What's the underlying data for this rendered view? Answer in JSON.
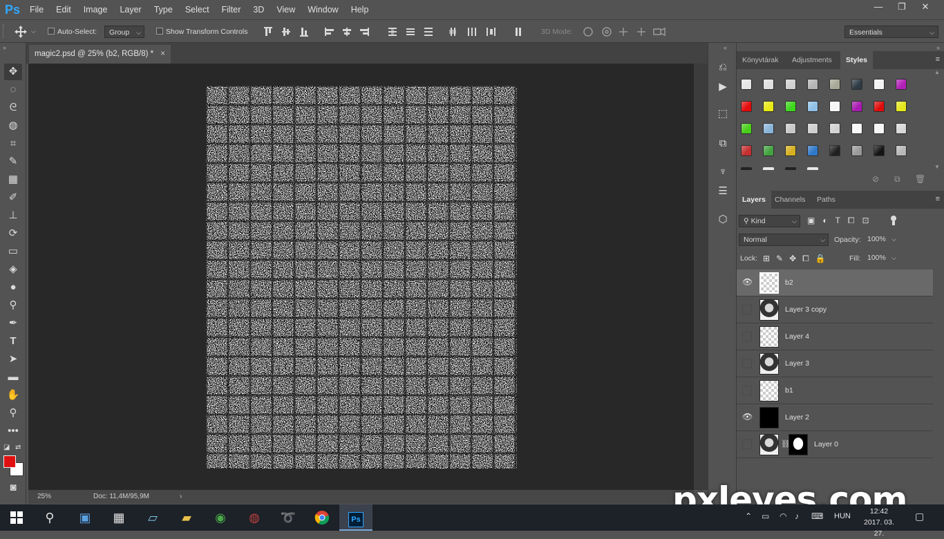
{
  "app": {
    "logo": "Ps"
  },
  "menu": [
    "File",
    "Edit",
    "Image",
    "Layer",
    "Type",
    "Select",
    "Filter",
    "3D",
    "View",
    "Window",
    "Help"
  ],
  "window_controls": {
    "minimize": "—",
    "restore": "❐",
    "close": "✕"
  },
  "options": {
    "auto_select_label": "Auto-Select:",
    "auto_select_value": "Group",
    "show_transform_label": "Show Transform Controls",
    "mode_3d_label": "3D Mode:",
    "workspace": "Essentials"
  },
  "document": {
    "tab_title": "magic2.psd @ 25% (b2, RGB/8) *",
    "tab_close": "×",
    "zoom": "25%",
    "doc_size": "Doc: 11,4M/95,9M",
    "status_arrow": "›"
  },
  "styles_panel": {
    "tabs": [
      "Könyvtárak",
      "Adjustments",
      "Styles"
    ],
    "active_tab": "Styles",
    "swatches": [
      [
        "#e6e6e6",
        "#e0e0e0",
        "#d0d0d0",
        "#b4b4b4",
        "#a8a898",
        "#2e3a44",
        "#f2f2f2",
        "#b21fb6"
      ],
      [
        "#e30b0b",
        "#e8e815",
        "#3ed61c",
        "#8fc0e6",
        "#f5f5f5",
        "#a81ab0",
        "#e00c0c",
        "#e6e61c"
      ],
      [
        "#49cf1a",
        "#8ab4d8",
        "#c8c8c8",
        "#cfcfcf",
        "#d2d2d2",
        "#f8f8f8",
        "#f6f6f6",
        "#d8d8d8"
      ],
      [
        "#c43030",
        "#44a340",
        "#d6b020",
        "#2f78c8",
        "#202020",
        "#9a9a9a",
        "#141414",
        "#b8b8b8"
      ]
    ]
  },
  "layers_panel": {
    "tabs": [
      "Layers",
      "Channels",
      "Paths"
    ],
    "active_tab": "Layers",
    "filter_kind": "Kind",
    "blend_mode": "Normal",
    "opacity_label": "Opacity:",
    "opacity_value": "100%",
    "lock_label": "Lock:",
    "fill_label": "Fill:",
    "fill_value": "100%",
    "layers": [
      {
        "name": "b2",
        "visible": true,
        "selected": true,
        "thumb": "transparent"
      },
      {
        "name": "Layer 3 copy",
        "visible": false,
        "selected": false,
        "thumb": "portrait"
      },
      {
        "name": "Layer 4",
        "visible": false,
        "selected": false,
        "thumb": "transparent"
      },
      {
        "name": "Layer 3",
        "visible": false,
        "selected": false,
        "thumb": "portrait"
      },
      {
        "name": "b1",
        "visible": false,
        "selected": false,
        "thumb": "transparent"
      },
      {
        "name": "Layer 2",
        "visible": true,
        "selected": false,
        "thumb": "black"
      },
      {
        "name": "Layer 0",
        "visible": false,
        "selected": false,
        "thumb": "portrait-mask"
      }
    ]
  },
  "taskbar": {
    "language": "HUN",
    "time": "12:42",
    "date": "2017. 03. 27."
  },
  "watermark": "pxleyes.com",
  "colors": {
    "foreground": "#e01010",
    "background": "#ffffff",
    "accent": "#31a8ff"
  }
}
